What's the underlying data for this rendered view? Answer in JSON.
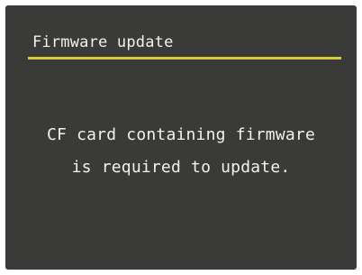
{
  "screen": {
    "title": "Firmware update",
    "message_line1": "CF card containing firmware",
    "message_line2": "is required to update."
  },
  "colors": {
    "background": "#3a3a38",
    "text": "#f2f2ec",
    "accent_rule": "#d7c93a"
  }
}
